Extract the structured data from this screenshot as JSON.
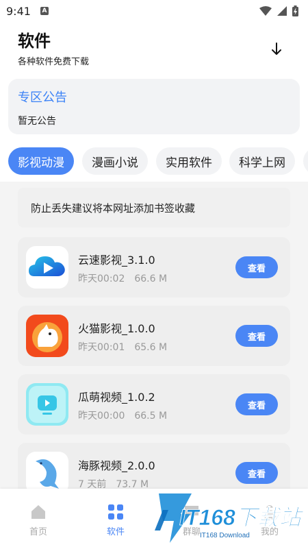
{
  "status_bar": {
    "time": "9:41",
    "notification_glyph": "A"
  },
  "header": {
    "title": "软件",
    "subtitle": "各种软件免费下载",
    "download_icon": "download-arrow-icon"
  },
  "notice": {
    "title": "专区公告",
    "text": "暂无公告"
  },
  "tabs": [
    {
      "label": "影视动漫",
      "active": true
    },
    {
      "label": "漫画小说",
      "active": false
    },
    {
      "label": "实用软件",
      "active": false
    },
    {
      "label": "科学上网",
      "active": false
    }
  ],
  "bookmark_tip": "防止丢失建议将本网址添加书签收藏",
  "apps": [
    {
      "name": "云速影视_3.1.0",
      "time": "昨天00:02",
      "size": "66.6 M",
      "action": "查看",
      "icon": "cloud-play-icon"
    },
    {
      "name": "火猫影视_1.0.0",
      "time": "昨天00:01",
      "size": "65.6 M",
      "action": "查看",
      "icon": "fire-cat-icon"
    },
    {
      "name": "瓜萌视频_1.0.2",
      "time": "昨天00:00",
      "size": "66.5 M",
      "action": "查看",
      "icon": "tv-play-icon"
    },
    {
      "name": "海豚视频_2.0.0",
      "time": "7 天前",
      "size": "73.7 M",
      "action": "查看",
      "icon": "dolphin-icon"
    }
  ],
  "bottom_nav": [
    {
      "label": "首页",
      "icon": "home-icon",
      "active": false
    },
    {
      "label": "软件",
      "icon": "grid-icon",
      "active": true
    },
    {
      "label": "群聊",
      "icon": "chat-icon",
      "active": false
    },
    {
      "label": "我的",
      "icon": "user-icon",
      "active": false
    }
  ],
  "watermark": {
    "main": "IT168下载站",
    "sub": "IT168 Download"
  },
  "colors": {
    "accent": "#4a86f5",
    "notice_title": "#3b82f6",
    "card_bg": "#eeeeee"
  }
}
